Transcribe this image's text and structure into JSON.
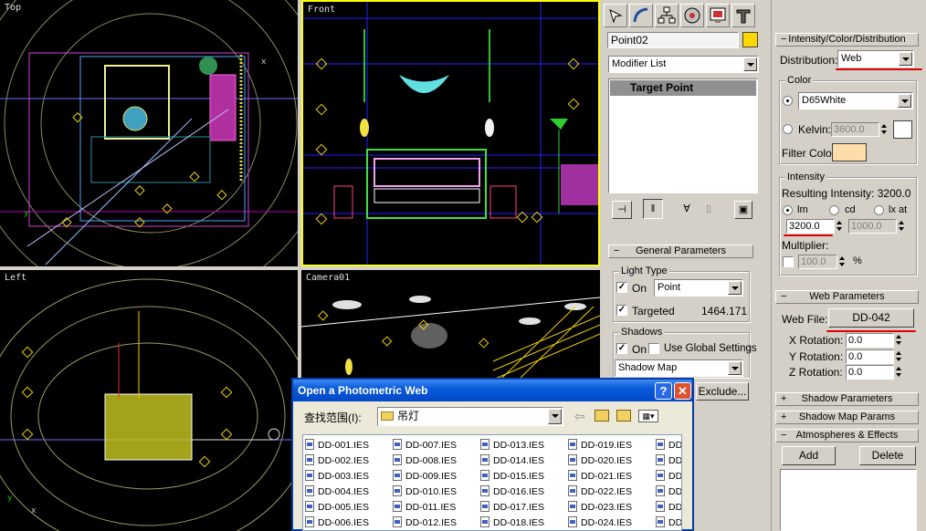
{
  "viewports": {
    "top": {
      "label": "Top"
    },
    "front": {
      "label": "Front"
    },
    "left": {
      "label": "Left"
    },
    "camera": {
      "label": "Camera01"
    }
  },
  "command_panel": {
    "tool_tabs": [
      "create-icon",
      "modify-icon",
      "hierarchy-icon",
      "motion-icon",
      "display-icon",
      "utilities-icon"
    ],
    "object_name": "Point02",
    "object_color": "#ffd800",
    "modifier_list": "Modifier List",
    "stack_item": "Target Point"
  },
  "general_parameters": {
    "header": "General Parameters",
    "light_type_title": "Light Type",
    "on_label": "On",
    "type_value": "Point",
    "targeted_label": "Targeted",
    "target_distance": "1464.171",
    "shadows_title": "Shadows",
    "shadows_on_label": "On",
    "use_global_label": "Use Global Settings",
    "shadow_type": "Shadow Map",
    "exclude_label": "Exclude..."
  },
  "intensity": {
    "header": "Intensity/Color/Distribution",
    "distribution_label": "Distribution:",
    "distribution_value": "Web",
    "color_title": "Color",
    "color_preset": "D65White",
    "kelvin_label": "Kelvin:",
    "kelvin_value": "3600.0",
    "filter_color_label": "Filter Color:",
    "filter_color": "#ffdcaa",
    "intensity_title": "Intensity",
    "resulting_label": "Resulting Intensity: 3200.0",
    "unit_lm": "lm",
    "unit_cd": "cd",
    "unit_lx": "lx at",
    "lm_value": "3200.0",
    "lx_value": "1000.0",
    "multiplier_label": "Multiplier:",
    "multiplier_value": "100.0",
    "percent": "%"
  },
  "web_parameters": {
    "header": "Web Parameters",
    "web_file_label": "Web File:",
    "web_file_value": "DD-042",
    "x_rot_label": "X Rotation:",
    "x_rot": "0.0",
    "y_rot_label": "Y Rotation:",
    "y_rot": "0.0",
    "z_rot_label": "Z Rotation:",
    "z_rot": "0.0"
  },
  "collapsed_rollouts": [
    "Shadow Parameters",
    "Shadow Map Params"
  ],
  "atmospheres": {
    "header": "Atmospheres & Effects",
    "add_label": "Add",
    "delete_label": "Delete"
  },
  "dialog": {
    "title": "Open a Photometric Web",
    "help": "?",
    "close": "✕",
    "look_in_label": "查找范围(I):",
    "look_in_value": "吊灯",
    "files": [
      [
        "DD-001.IES",
        "DD-002.IES",
        "DD-003.IES",
        "DD-004.IES",
        "DD-005.IES",
        "DD-006.IES"
      ],
      [
        "DD-007.IES",
        "DD-008.IES",
        "DD-009.IES",
        "DD-010.IES",
        "DD-011.IES",
        "DD-012.IES"
      ],
      [
        "DD-013.IES",
        "DD-014.IES",
        "DD-015.IES",
        "DD-016.IES",
        "DD-017.IES",
        "DD-018.IES"
      ],
      [
        "DD-019.IES",
        "DD-020.IES",
        "DD-021.IES",
        "DD-022.IES",
        "DD-023.IES",
        "DD-024.IES"
      ],
      [
        "DD",
        "DD",
        "DD",
        "DD",
        "DD",
        "DD"
      ]
    ]
  }
}
